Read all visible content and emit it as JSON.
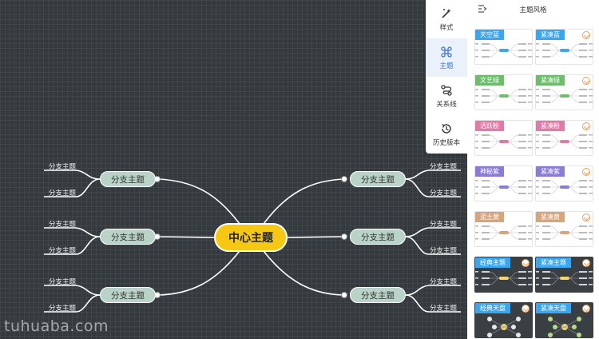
{
  "mindmap": {
    "center": "中心主题",
    "branches": [
      {
        "label": "分支主题",
        "leaves": [
          "分支主题",
          "分支主题"
        ]
      },
      {
        "label": "分支主题",
        "leaves": [
          "分支主题",
          "分支主题"
        ]
      },
      {
        "label": "分支主题",
        "leaves": [
          "分支主题",
          "分支主题"
        ]
      },
      {
        "label": "分支主题",
        "leaves": [
          "分支主题",
          "分支主题"
        ]
      },
      {
        "label": "分支主题",
        "leaves": [
          "分支主题",
          "分支主题"
        ]
      },
      {
        "label": "分支主题",
        "leaves": [
          "分支主题",
          "分支主题"
        ]
      }
    ]
  },
  "toolbar": {
    "items": [
      {
        "label": "样式",
        "icon": "magic-wand-icon",
        "active": false
      },
      {
        "label": "主题",
        "icon": "command-icon",
        "active": true
      },
      {
        "label": "关系线",
        "icon": "relation-line-icon",
        "active": false
      },
      {
        "label": "历史版本",
        "icon": "history-icon",
        "active": false
      }
    ]
  },
  "panel": {
    "title": "主题风格",
    "themes": [
      {
        "label": "天空蓝",
        "color": "#3aa6f0",
        "dark": false,
        "badge": false
      },
      {
        "label": "紧凑蓝",
        "color": "#3aa6f0",
        "dark": false,
        "badge": true
      },
      {
        "label": "文艺绿",
        "color": "#6dbd6d",
        "dark": false,
        "badge": false
      },
      {
        "label": "紧凑绿",
        "color": "#6dbd6d",
        "dark": false,
        "badge": true
      },
      {
        "label": "活跃粉",
        "color": "#e27aa8",
        "dark": false,
        "badge": false
      },
      {
        "label": "紧凑粉",
        "color": "#e27aa8",
        "dark": false,
        "badge": true
      },
      {
        "label": "神秘紫",
        "color": "#8b7bd6",
        "dark": false,
        "badge": false
      },
      {
        "label": "紧凑紫",
        "color": "#8b7bd6",
        "dark": false,
        "badge": true
      },
      {
        "label": "泥土黄",
        "color": "#d7a57c",
        "dark": false,
        "badge": false
      },
      {
        "label": "紧凑黄",
        "color": "#d7a57c",
        "dark": false,
        "badge": true
      },
      {
        "label": "经典主题",
        "color": "#3aa6f0",
        "dark": true,
        "badge": true
      },
      {
        "label": "紧凑主题",
        "color": "#3aa6f0",
        "dark": true,
        "badge": true
      },
      {
        "label": "经典天盘",
        "color": "#3aa6f0",
        "dark": true,
        "badge": true
      },
      {
        "label": "紧凑天盘",
        "color": "#3aa6f0",
        "dark": true,
        "badge": true
      }
    ]
  },
  "watermark": "tuhuaba.com",
  "colors": {
    "canvas": "#343a3e",
    "center_node": "#f6c814",
    "branch_node": "#b9d3c8",
    "active_tool": "#3b74d8"
  }
}
